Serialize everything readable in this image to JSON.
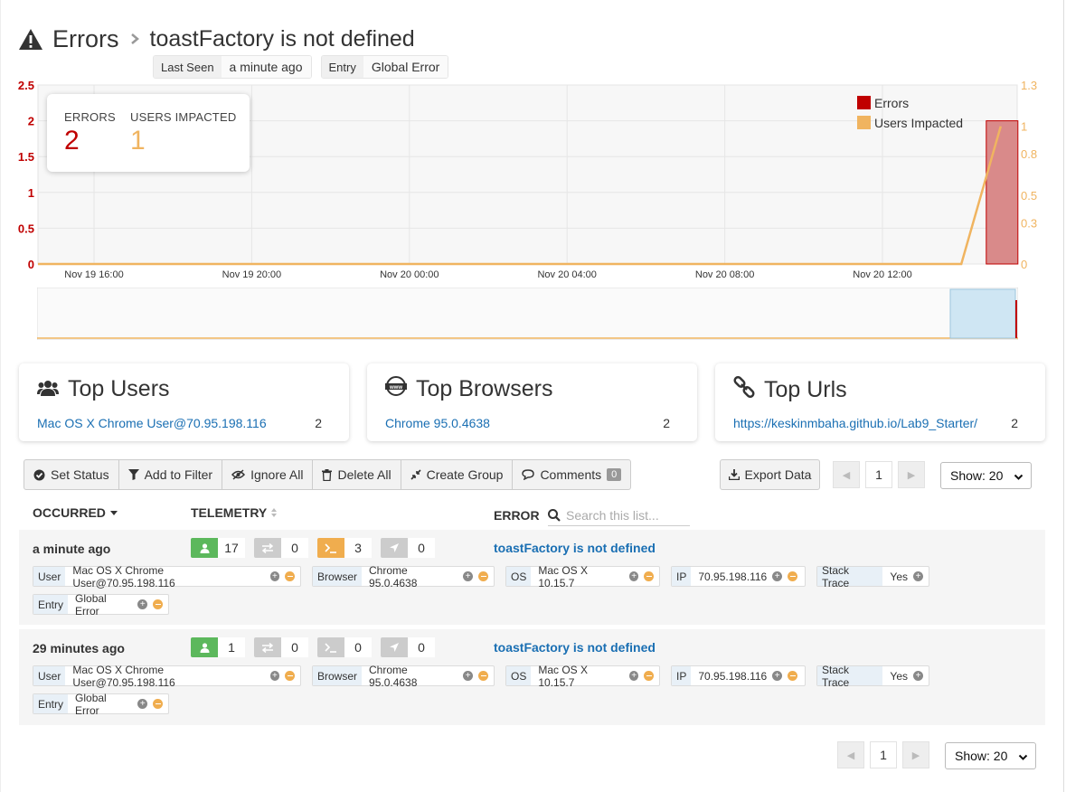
{
  "header": {
    "title": "Errors",
    "subtitle": "toastFactory is not defined"
  },
  "tags": [
    {
      "key": "Last Seen",
      "value": "a minute ago"
    },
    {
      "key": "Entry",
      "value": "Global Error"
    }
  ],
  "stats": {
    "errors_label": "ERRORS",
    "errors_value": "2",
    "users_label": "USERS IMPACTED",
    "users_value": "1"
  },
  "colors": {
    "errors": "#c00000",
    "users": "#f0b460",
    "link": "#1a6fb3"
  },
  "chart_data": {
    "type": "bar",
    "x": [
      "Nov 19 16:00",
      "Nov 19 20:00",
      "Nov 20 00:00",
      "Nov 20 04:00",
      "Nov 20 08:00",
      "Nov 20 12:00"
    ],
    "left_axis": {
      "ticks": [
        "2.5",
        "2",
        "1.5",
        "1",
        "0.5",
        "0"
      ],
      "ylim": [
        0,
        2.5
      ]
    },
    "right_axis": {
      "ticks": [
        "1.3",
        "1",
        "0.8",
        "0.5",
        "0.3",
        "0"
      ],
      "ylim": [
        0,
        1.3
      ]
    },
    "legend": {
      "position": "top-right",
      "entries": [
        "Errors",
        "Users Impacted"
      ]
    },
    "grid": true,
    "series": [
      {
        "name": "Errors",
        "type": "bar",
        "points": [
          {
            "x": "Nov 20 15:00",
            "y": 2
          }
        ]
      },
      {
        "name": "Users Impacted",
        "type": "line",
        "points": [
          {
            "x": "Nov 19 14:00",
            "y": 0
          },
          {
            "x": "Nov 20 14:00",
            "y": 0
          },
          {
            "x": "Nov 20 15:00",
            "y": 1
          }
        ]
      }
    ]
  },
  "panels": [
    {
      "title": "Top Users",
      "icon": "users-icon",
      "link": "Mac OS X Chrome User@70.95.198.116",
      "count": "2"
    },
    {
      "title": "Top Browsers",
      "icon": "www-icon",
      "link": "Chrome 95.0.4638",
      "count": "2"
    },
    {
      "title": "Top Urls",
      "icon": "link-icon",
      "link": "https://keskinmbaha.github.io/Lab9_Starter/",
      "count": "2"
    }
  ],
  "toolbar": {
    "set_status": "Set Status",
    "add_filter": "Add to Filter",
    "ignore_all": "Ignore All",
    "delete_all": "Delete All",
    "create_group": "Create Group",
    "comments": "Comments",
    "comments_count": "0",
    "export": "Export Data"
  },
  "pager": {
    "page": "1",
    "show": "Show: 20"
  },
  "table": {
    "col_occurred": "OCCURRED",
    "col_telemetry": "TELEMETRY",
    "col_error": "ERROR",
    "search_placeholder": "Search this list..."
  },
  "rows": [
    {
      "occurred": "a minute ago",
      "users": "17",
      "network": "0",
      "console": "3",
      "navigation": "0",
      "error": "toastFactory is not defined",
      "chips": [
        {
          "k": "User",
          "v": "Mac OS X Chrome User@70.95.198.116"
        },
        {
          "k": "Browser",
          "v": "Chrome 95.0.4638"
        },
        {
          "k": "OS",
          "v": "Mac OS X 10.15.7"
        },
        {
          "k": "IP",
          "v": "70.95.198.116"
        },
        {
          "k": "Stack Trace",
          "v": "Yes"
        },
        {
          "k": "Entry",
          "v": "Global Error"
        }
      ]
    },
    {
      "occurred": "29 minutes ago",
      "users": "1",
      "network": "0",
      "console": "0",
      "navigation": "0",
      "error": "toastFactory is not defined",
      "chips": [
        {
          "k": "User",
          "v": "Mac OS X Chrome User@70.95.198.116"
        },
        {
          "k": "Browser",
          "v": "Chrome 95.0.4638"
        },
        {
          "k": "OS",
          "v": "Mac OS X 10.15.7"
        },
        {
          "k": "IP",
          "v": "70.95.198.116"
        },
        {
          "k": "Stack Trace",
          "v": "Yes"
        },
        {
          "k": "Entry",
          "v": "Global Error"
        }
      ]
    }
  ]
}
